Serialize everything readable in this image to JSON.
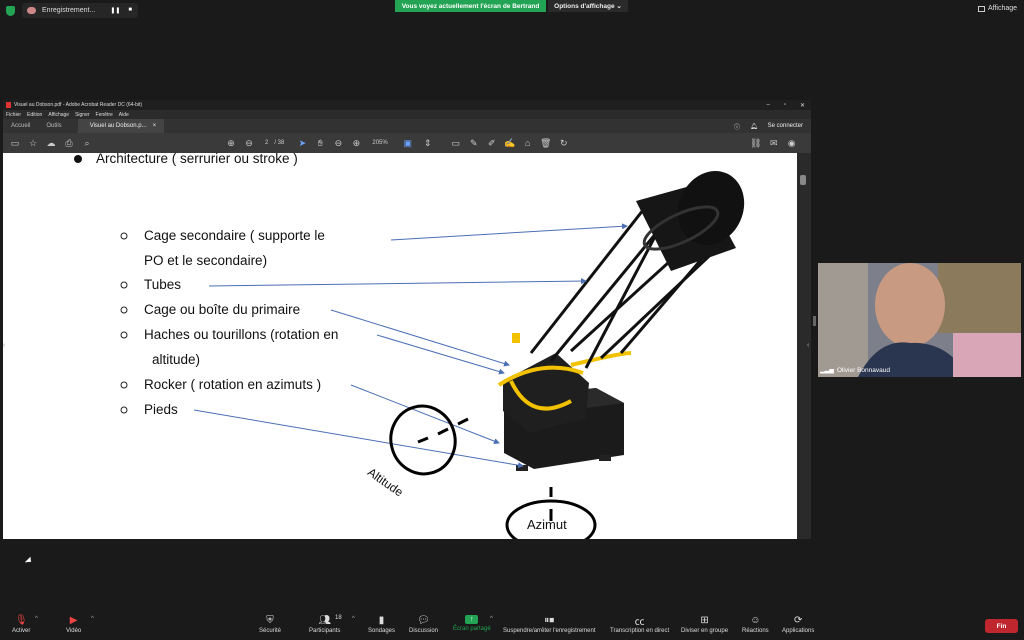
{
  "top_bar": {
    "recording_label": "Enregistrement...",
    "pause_glyph": "❚❚",
    "stop_glyph": "■",
    "share_banner": "Vous voyez actuellement l'écran de Bertrand",
    "view_options": "Options d'affichage ⌄",
    "view_label": "Affichage"
  },
  "acrobat": {
    "title": "Visuel au Dobson.pdf - Adobe Acrobat Reader DC (64-bit)",
    "menu": [
      "Fichier",
      "Edition",
      "Affichage",
      "Signer",
      "Fenêtre",
      "Aide"
    ],
    "tabs": [
      "Accueil",
      "Outils"
    ],
    "doc_tab": "Visuel au Dobson.p...",
    "doc_tab_close": "×",
    "signin": "Se connecter",
    "page_current": "2",
    "page_total": "/ 38",
    "zoom": "205%"
  },
  "slide": {
    "bullet_main": "Architecture ( serrurier ou stroke )",
    "items": [
      "Cage secondaire ( supporte le",
      "PO  et le secondaire)",
      "Tubes",
      "Cage ou boîte du primaire",
      "Haches ou tourillons (rotation en",
      "altitude)",
      "Rocker ( rotation en azimuts )",
      "Pieds"
    ],
    "label_altitude": "Altitude",
    "label_azimut": "Azimut"
  },
  "video": {
    "participant_name": "Olivier Bonnavaud"
  },
  "bottom_bar": {
    "activer": "Activer",
    "video": "Vidéo",
    "securite": "Sécurité",
    "participants": "Participants",
    "participants_count": "18",
    "sondages": "Sondages",
    "discussion": "Discussion",
    "ecran_partage": "Écran partagé",
    "suspendre": "Suspendre/arrêter l'enregistrement",
    "transcription": "Transcription en direct",
    "diviser": "Diviser en groupe",
    "reactions": "Réactions",
    "applications": "Applications",
    "fin": "Fin"
  },
  "colors": {
    "zoom_green": "#23a455",
    "end_red": "#c0262d",
    "arrow_blue": "#4a6fb5",
    "mount_yellow": "#f2c200"
  }
}
